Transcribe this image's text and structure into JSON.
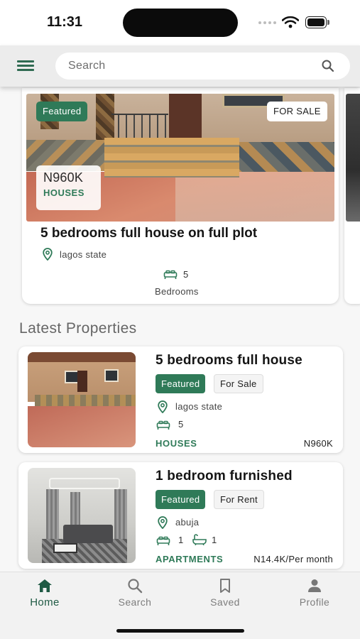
{
  "status_bar": {
    "time": "11:31"
  },
  "search": {
    "placeholder": "Search"
  },
  "featured": {
    "badge": "Featured",
    "status": "FOR SALE",
    "price": "N960K",
    "type": "HOUSES",
    "title": "5 bedrooms full house on full plot",
    "location": "lagos state",
    "bedrooms": "5",
    "bedrooms_label": "Bedrooms"
  },
  "latest": {
    "title": "Latest Properties",
    "items": [
      {
        "title": "5 bedrooms full house",
        "badge": "Featured",
        "status": "For Sale",
        "location": "lagos state",
        "bedrooms": "5",
        "type": "HOUSES",
        "price": "N960K"
      },
      {
        "title": "1 bedroom furnished",
        "badge": "Featured",
        "status": "For Rent",
        "location": "abuja",
        "bedrooms": "1",
        "bathrooms": "1",
        "type": "APARTMENTS",
        "price": "N14.4K/Per month"
      }
    ]
  },
  "nav": {
    "items": [
      {
        "label": "Home",
        "icon": "home-icon"
      },
      {
        "label": "Search",
        "icon": "search-icon"
      },
      {
        "label": "Saved",
        "icon": "bookmark-icon"
      },
      {
        "label": "Profile",
        "icon": "person-icon"
      }
    ],
    "active": "Home"
  },
  "colors": {
    "brand": "#2f7a58",
    "active_nav": "#1f5a44"
  }
}
